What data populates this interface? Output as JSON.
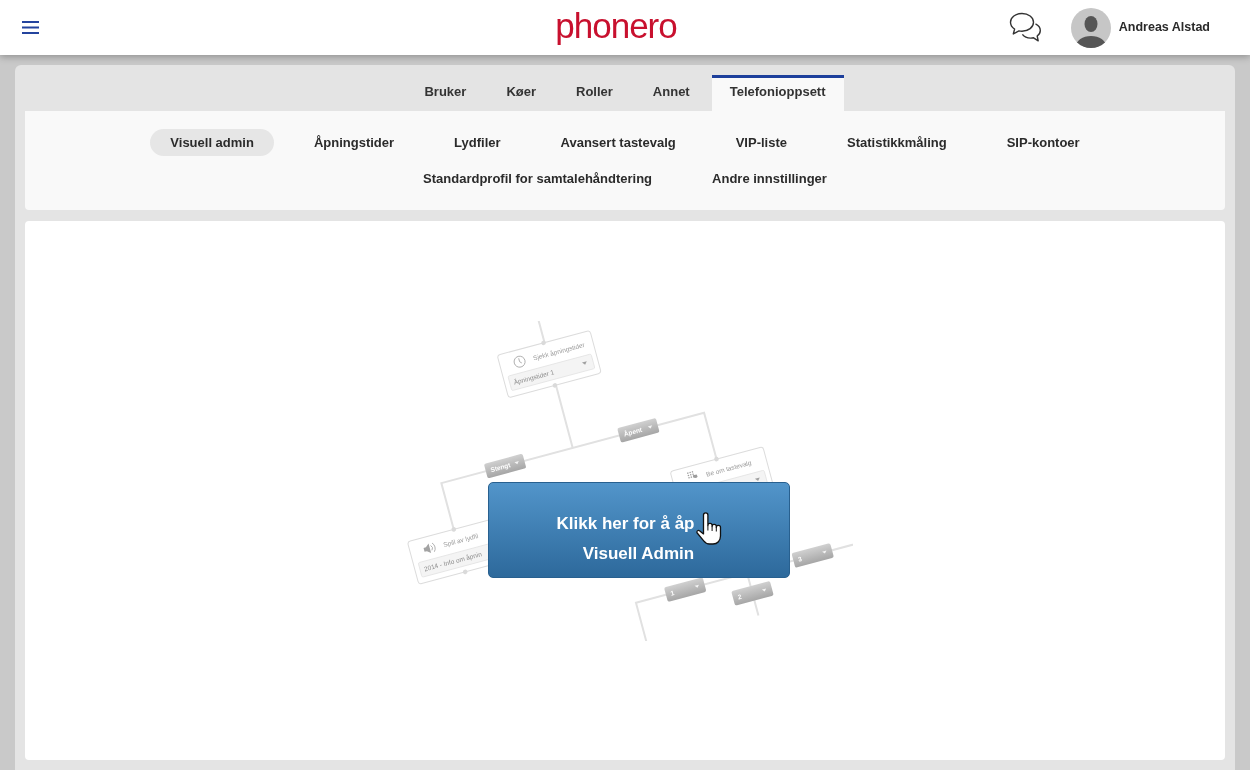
{
  "header": {
    "logo": "phonero",
    "user_name": "Andreas Alstad"
  },
  "tabs": [
    {
      "label": "Bruker",
      "selected": false
    },
    {
      "label": "Køer",
      "selected": false
    },
    {
      "label": "Roller",
      "selected": false
    },
    {
      "label": "Annet",
      "selected": false
    },
    {
      "label": "Telefonioppsett",
      "selected": true
    }
  ],
  "subtabs": [
    {
      "label": "Visuell admin",
      "selected": true
    },
    {
      "label": "Åpningstider",
      "selected": false
    },
    {
      "label": "Lydfiler",
      "selected": false
    },
    {
      "label": "Avansert tastevalg",
      "selected": false
    },
    {
      "label": "VIP-liste",
      "selected": false
    },
    {
      "label": "Statistikkmåling",
      "selected": false
    },
    {
      "label": "SIP-kontoer",
      "selected": false
    },
    {
      "label": "Standardprofil for samtalehåndtering",
      "selected": false
    },
    {
      "label": "Andre innstillinger",
      "selected": false
    }
  ],
  "preview": {
    "nodes": [
      {
        "kind": "clock",
        "title": "Sjekk åpningstider",
        "value": "Åpningstider 1"
      },
      {
        "kind": "keypad",
        "title": "Be om tastevalg"
      },
      {
        "kind": "speaker",
        "title": "Spill av lydfil",
        "value": "2014 - Info om åpnin"
      }
    ],
    "branches": [
      "Stengt",
      "Åpent",
      "1",
      "2",
      "3"
    ]
  },
  "open_button": {
    "lines": [
      "Klikk her for å åp",
      "Visuell Admin"
    ]
  }
}
